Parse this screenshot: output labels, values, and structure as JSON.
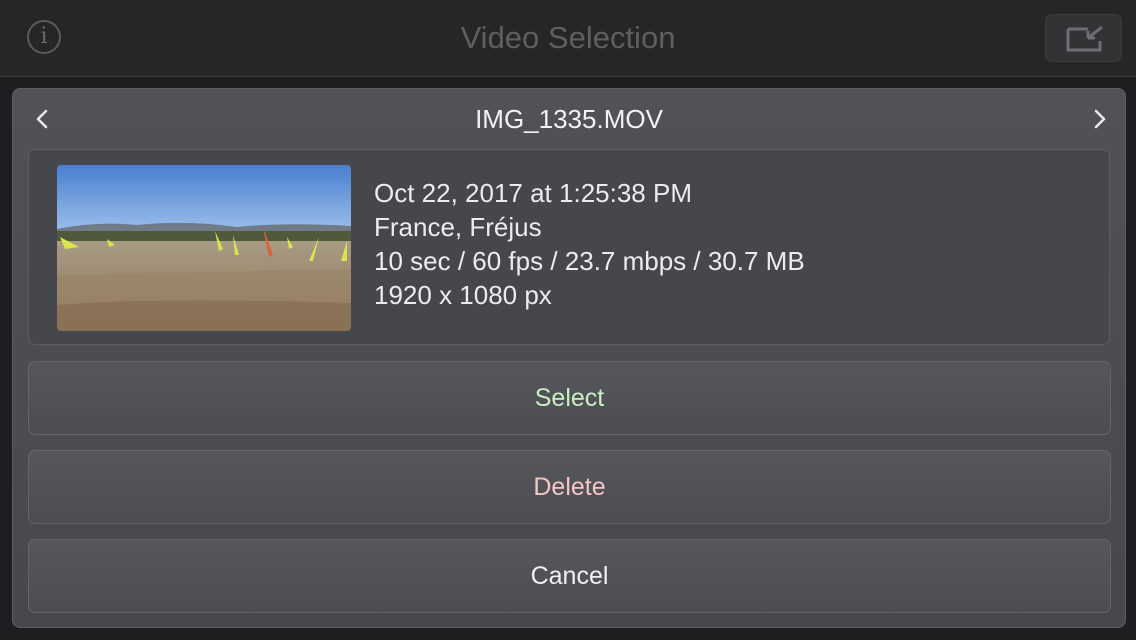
{
  "navbar": {
    "title": "Video Selection",
    "info_icon": "info-icon",
    "info_glyph": "i",
    "export_icon": "export-icon"
  },
  "dialog": {
    "title": "IMG_1335.MOV",
    "prev_icon": "chevron-left-icon",
    "next_icon": "chevron-right-icon",
    "details": {
      "date": "Oct 22, 2017 at 1:25:38 PM",
      "location": "France, Fréjus",
      "stats": "10 sec / 60 fps / 23.7 mbps / 30.7 MB",
      "resolution": "1920 x 1080 px"
    },
    "buttons": {
      "select": "Select",
      "delete": "Delete",
      "cancel": "Cancel"
    }
  },
  "colors": {
    "select_text": "#c8f0c0",
    "delete_text": "#f4c6c6",
    "dialog_bg": "#4d4f54"
  }
}
